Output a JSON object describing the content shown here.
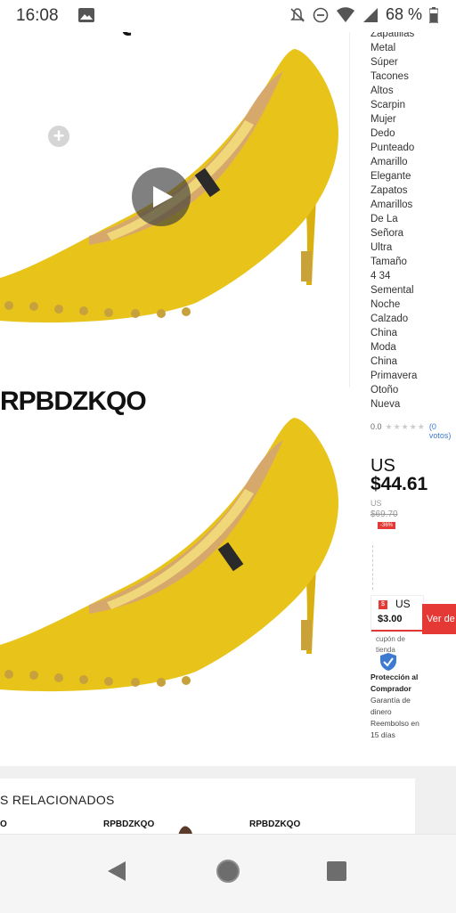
{
  "status_bar": {
    "time": "16:08",
    "battery": "68 %",
    "icons": [
      "image-icon",
      "mute-icon",
      "dnd-icon",
      "wifi-icon",
      "signal-icon",
      "battery-icon"
    ]
  },
  "gallery": {
    "brand": "RPBDZKQO",
    "brand_partial_top": "RPBDZKQO"
  },
  "product": {
    "title_lines": [
      "Zapatillas",
      "Metal",
      "Súper",
      "Tacones",
      "Altos",
      "Scarpin",
      "Mujer",
      "Dedo",
      "Punteado",
      "Amarillo",
      "Elegante",
      "Zapatos",
      "Amarillos",
      "De La",
      "Señora",
      "Ultra",
      "Tamaño",
      "4 34",
      "Semental",
      "Noche",
      "Calzado",
      "China",
      "Moda",
      "China",
      "Primavera",
      "Otoño",
      "Nueva"
    ],
    "rating": "0.0",
    "votes": "(0 votos)",
    "price_currency": "US",
    "price_value": "$44.61",
    "original_currency": "US",
    "original_value": "$69.70",
    "discount_badge": "-36%"
  },
  "coupon": {
    "currency": "US",
    "amount": "$3.00",
    "button_label": "Ver de",
    "text": "cupón de tienda"
  },
  "protection": {
    "title": "Protección al Comprador",
    "text": "Garantía de dinero Reembolso en 15 días"
  },
  "related": {
    "title": "S RELACIONADOS",
    "brands": [
      "O",
      "RPBDZKQO",
      "RPBDZKQO"
    ]
  },
  "colors": {
    "accent": "#e53935",
    "shoe_yellow": "#e6c21a"
  }
}
